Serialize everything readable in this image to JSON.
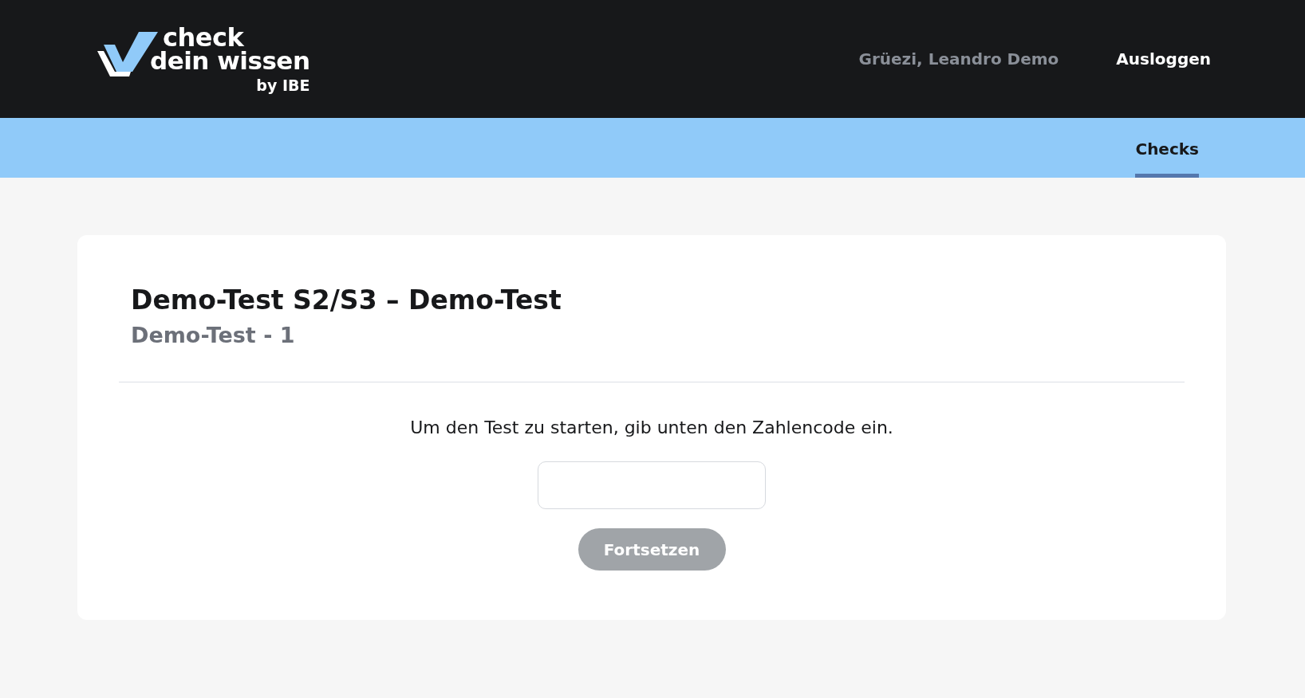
{
  "logo": {
    "line_1": "check",
    "line_2": "dein wissen",
    "byline": "by IBE"
  },
  "header": {
    "greeting": "Grüezi, Leandro Demo",
    "logout": "Ausloggen"
  },
  "nav": [
    {
      "label": "Checks",
      "selected": true
    }
  ],
  "card": {
    "title": "Demo-Test S2/S3 – Demo-Test",
    "subtitle": "Demo-Test - 1",
    "instruction": "Um den Test zu starten, gib unten den Zahlencode ein.",
    "button": {
      "label": "Fortsetzen",
      "disabled": true
    }
  }
}
